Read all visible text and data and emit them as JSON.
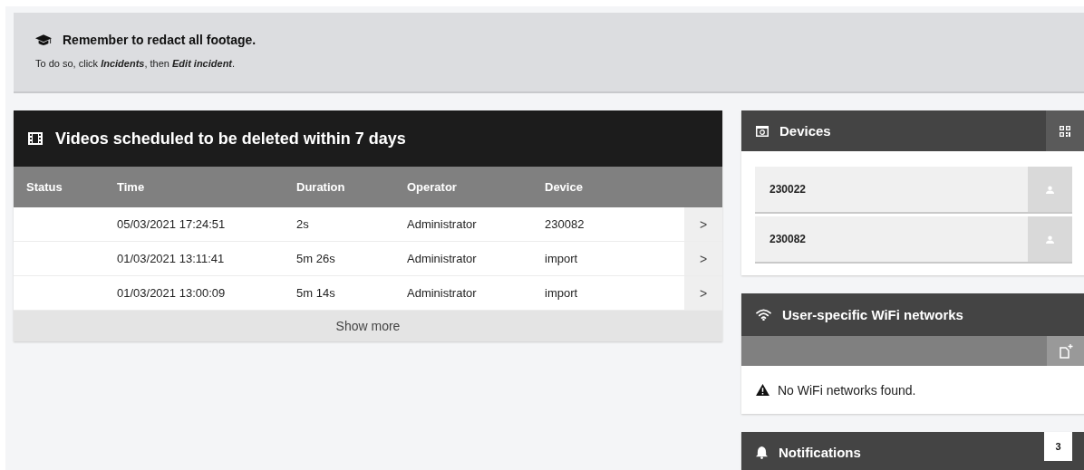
{
  "banner": {
    "title": "Remember to redact all footage.",
    "text": "To do so, click **Incidents**, then **Edit incident**."
  },
  "videos": {
    "title": "Videos scheduled to be deleted within 7 days",
    "columns": [
      "Status",
      "Time",
      "Duration",
      "Operator",
      "Device"
    ],
    "rows": [
      {
        "time": "05/03/2021 17:24:51",
        "duration": "2s",
        "operator": "Administrator",
        "device": "230082",
        "arrow": ">"
      },
      {
        "time": "01/03/2021 13:11:41",
        "duration": "5m 26s",
        "operator": "Administrator",
        "device": "import",
        "arrow": ">"
      },
      {
        "time": "01/03/2021 13:00:09",
        "duration": "5m 14s",
        "operator": "Administrator",
        "device": "import",
        "arrow": ">"
      }
    ],
    "show_more": "Show more"
  },
  "devices": {
    "title": "Devices",
    "items": [
      {
        "name": "230022"
      },
      {
        "name": "230082"
      }
    ]
  },
  "wifi": {
    "title": "User-specific WiFi networks",
    "message": "No WiFi networks found."
  },
  "notifications": {
    "title": "Notifications",
    "badge": "3"
  }
}
